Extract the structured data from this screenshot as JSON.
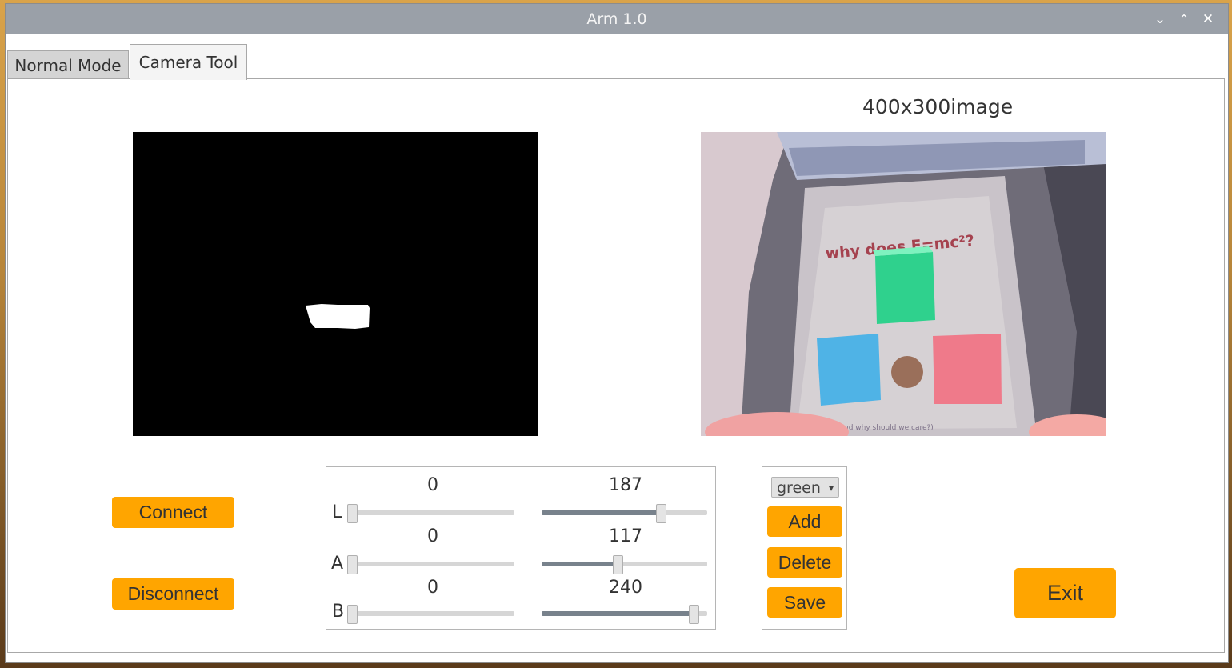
{
  "window": {
    "title": "Arm 1.0",
    "controls": [
      "chevron-down-icon",
      "chevron-up-icon",
      "close-icon"
    ]
  },
  "tabs": [
    {
      "label": "Normal Mode",
      "active": false
    },
    {
      "label": "Camera Tool",
      "active": true
    }
  ],
  "camera": {
    "caption": "400x300image"
  },
  "buttons": {
    "connect": "Connect",
    "disconnect": "Disconnect",
    "exit": "Exit"
  },
  "sliders": {
    "L": {
      "label": "L",
      "min_value": "0",
      "max_value": "187",
      "range": 255
    },
    "A": {
      "label": "A",
      "min_value": "0",
      "max_value": "117",
      "range": 255
    },
    "B": {
      "label": "B",
      "min_value": "0",
      "max_value": "240",
      "range": 255
    }
  },
  "color_control": {
    "selected": "green",
    "add": "Add",
    "delete": "Delete",
    "save": "Save"
  },
  "photo_text": {
    "headline": "why does E=mc²?",
    "footer": "(and why should we care?)"
  },
  "colors": {
    "accent": "#ffa500",
    "titlebar": "#9aa0a8",
    "slider_fill": "#78828c"
  }
}
